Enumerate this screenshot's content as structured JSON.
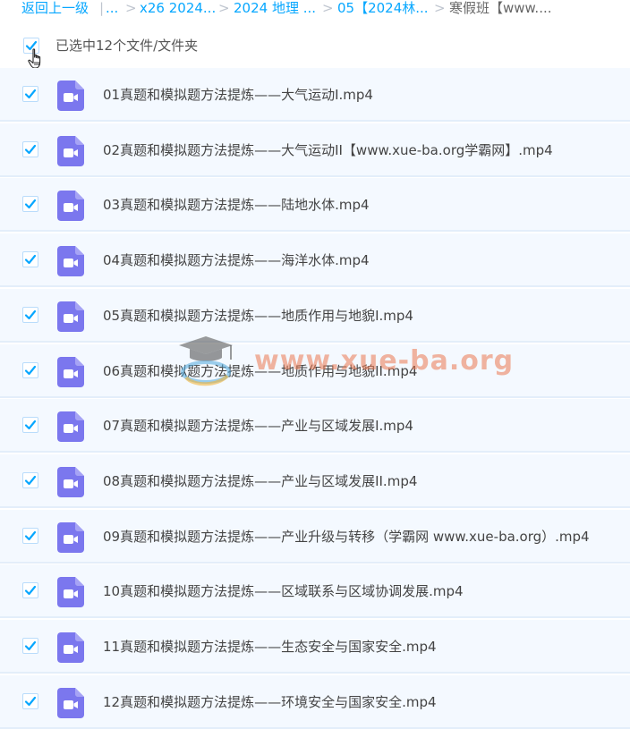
{
  "breadcrumb": {
    "back": "返回上一级",
    "sep_bar": "|",
    "items": [
      "...",
      "x26 2024...",
      "2024 地理 ...",
      "05【2024林..."
    ],
    "current": "寒假班【www...."
  },
  "selection": {
    "text": "已选中12个文件/文件夹",
    "checked": true
  },
  "files": [
    {
      "name": "01真题和模拟题方法提炼——大气运动I.mp4",
      "checked": true
    },
    {
      "name": "02真题和模拟题方法提炼——大气运动II【www.xue-ba.org学霸网】.mp4",
      "checked": true
    },
    {
      "name": "03真题和模拟题方法提炼——陆地水体.mp4",
      "checked": true
    },
    {
      "name": "04真题和模拟题方法提炼——海洋水体.mp4",
      "checked": true
    },
    {
      "name": "05真题和模拟题方法提炼——地质作用与地貌I.mp4",
      "checked": true
    },
    {
      "name": "06真题和模拟题方法提炼——地质作用与地貌II.mp4",
      "checked": true
    },
    {
      "name": "07真题和模拟题方法提炼——产业与区域发展I.mp4",
      "checked": true
    },
    {
      "name": "08真题和模拟题方法提炼——产业与区域发展II.mp4",
      "checked": true
    },
    {
      "name": "09真题和模拟题方法提炼——产业升级与转移（学霸网 www.xue-ba.org）.mp4",
      "checked": true
    },
    {
      "name": "10真题和模拟题方法提炼——区域联系与区域协调发展.mp4",
      "checked": true
    },
    {
      "name": "11真题和模拟题方法提炼——生态安全与国家安全.mp4",
      "checked": true
    },
    {
      "name": "12真题和模拟题方法提炼——环境安全与国家安全.mp4",
      "checked": true
    }
  ],
  "watermark": {
    "text": "www.xue-ba.org"
  },
  "icons": {
    "video_file": "video-file-icon",
    "checkbox": "checkmark-icon",
    "cursor": "hand-pointer-icon",
    "watermark_logo": "graduation-cap-icon"
  },
  "colors": {
    "link": "#06a7ff",
    "checkbox_check": "#06a7ff",
    "video_icon": "#7b77ee",
    "row_bg": "#f4f9ff"
  }
}
